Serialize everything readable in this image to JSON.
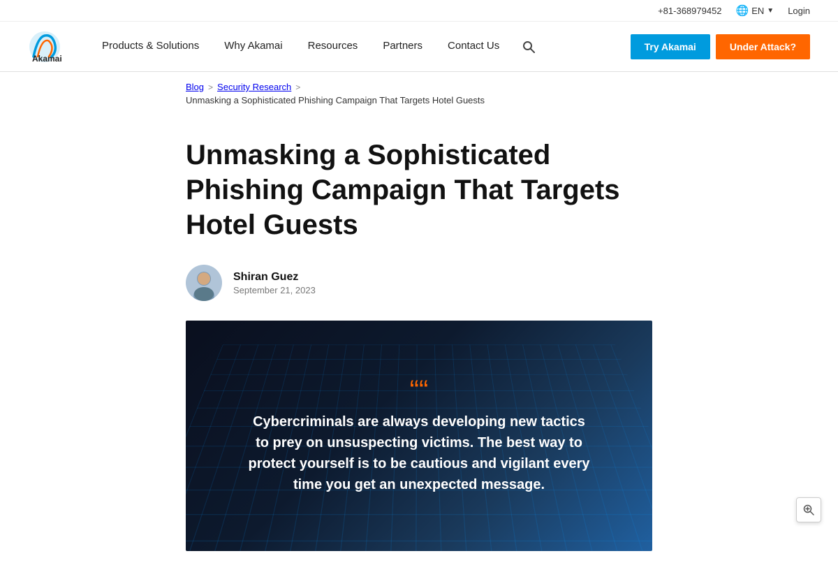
{
  "header": {
    "phone": "+81-368979452",
    "lang": "EN",
    "login_label": "Login",
    "nav_items": [
      {
        "label": "Products & Solutions",
        "has_dropdown": true
      },
      {
        "label": "Why Akamai",
        "has_dropdown": false
      },
      {
        "label": "Resources",
        "has_dropdown": false
      },
      {
        "label": "Partners",
        "has_dropdown": false
      },
      {
        "label": "Contact Us",
        "has_dropdown": false
      }
    ],
    "btn_try": "Try Akamai",
    "btn_attack": "Under Attack?"
  },
  "breadcrumb": {
    "blog": "Blog",
    "sep1": ">",
    "security_research": "Security Research",
    "sep2": ">",
    "current": "Unmasking a Sophisticated Phishing Campaign That Targets Hotel Guests"
  },
  "article": {
    "title": "Unmasking a Sophisticated Phishing Campaign That Targets Hotel Guests",
    "author_name": "Shiran Guez",
    "author_date": "September 21, 2023",
    "hero_quote_mark": "““",
    "hero_quote": "Cybercriminals are always developing new tactics to prey on unsuspecting victims. The best way to protect yourself is to be cautious and vigilant every time you get an unexpected message."
  },
  "zoom": {
    "icon": "🔍"
  }
}
